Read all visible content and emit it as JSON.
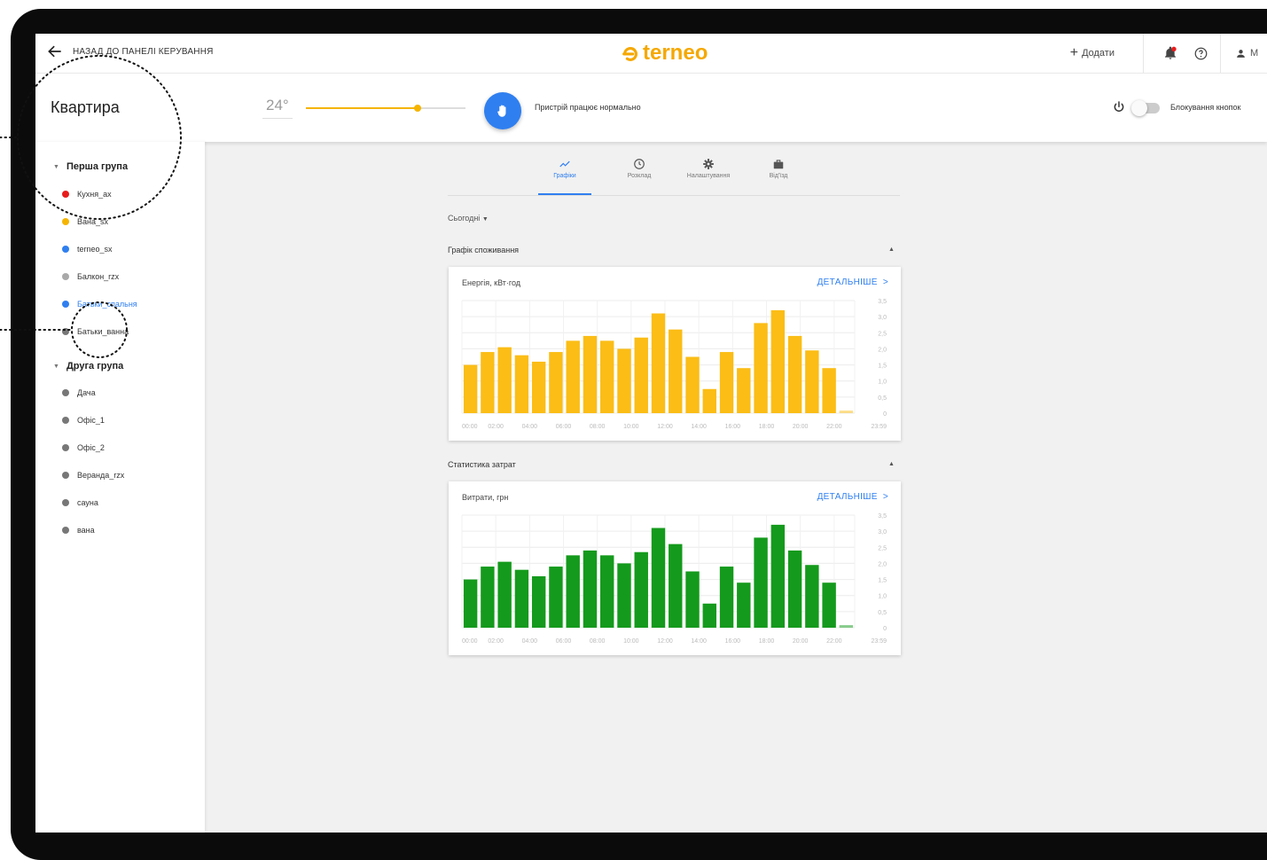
{
  "topbar": {
    "back_label": "НАЗАД ДО ПАНЕЛІ КЕРУВАННЯ",
    "logo_text": "terneo",
    "add_label": "Додати",
    "user_label": "M"
  },
  "device": {
    "room_title": "Квартира",
    "temperature": "24°",
    "status_text": "Пристрій працює нормально",
    "lock_label": "Блокування кнопок",
    "slider_level": 0.7
  },
  "sidebar": {
    "groups": [
      {
        "name": "Перша група",
        "items": [
          {
            "label": "Кухня_ах",
            "color": "#e81b1b"
          },
          {
            "label": "Вана_sx",
            "color": "#f5b400"
          },
          {
            "label": "terneo_sx",
            "color": "#2f7ff0"
          },
          {
            "label": "Балкон_rzx",
            "color": "#a9a9a9"
          },
          {
            "label": "Батьки_спальня",
            "color": "#2f7ff0"
          },
          {
            "label": "Батьки_ванна",
            "color": "#777777"
          }
        ]
      },
      {
        "name": "Друга група",
        "items": [
          {
            "label": "Дача",
            "color": "#777777"
          },
          {
            "label": "Офіс_1",
            "color": "#777777"
          },
          {
            "label": "Офіс_2",
            "color": "#777777"
          },
          {
            "label": "Веранда_rzx",
            "color": "#777777"
          },
          {
            "label": "сауна",
            "color": "#777777"
          },
          {
            "label": "вана",
            "color": "#777777"
          }
        ]
      }
    ]
  },
  "tabs": [
    {
      "label": "Графіки",
      "icon": "chart-line-icon"
    },
    {
      "label": "Розклад",
      "icon": "clock-icon"
    },
    {
      "label": "Налаштування",
      "icon": "gear-icon"
    },
    {
      "label": "Від'їзд",
      "icon": "suitcase-icon"
    }
  ],
  "period": "Сьогодні",
  "sections": {
    "consumption_title": "Графік споживання",
    "costs_title": "Статистика затрат",
    "more_label": "ДЕТАЛЬНІШЕ"
  },
  "chart_data": [
    {
      "type": "bar",
      "title": "Енергія, кВт·год",
      "color": "#fbbd16",
      "x_ticks": [
        "00:00",
        "02:00",
        "04:00",
        "06:00",
        "08:00",
        "10:00",
        "12:00",
        "14:00",
        "16:00",
        "18:00",
        "20:00",
        "22:00",
        "23:59"
      ],
      "y_ticks": [
        "3,5",
        "3,0",
        "2,5",
        "2,0",
        "1,5",
        "1,0",
        "0,5",
        "0"
      ],
      "ylim": [
        0,
        3.5
      ],
      "values": [
        1.5,
        1.9,
        2.05,
        1.8,
        1.6,
        1.9,
        2.25,
        2.4,
        2.25,
        2.0,
        2.35,
        3.1,
        2.6,
        1.75,
        0.75,
        1.9,
        1.4,
        2.8,
        3.2,
        2.4,
        1.95,
        1.4,
        0.08
      ],
      "grid": true
    },
    {
      "type": "bar",
      "title": "Витрати, грн",
      "color": "#149a1c",
      "x_ticks": [
        "00:00",
        "02:00",
        "04:00",
        "06:00",
        "08:00",
        "10:00",
        "12:00",
        "14:00",
        "16:00",
        "18:00",
        "20:00",
        "22:00",
        "23:59"
      ],
      "y_ticks": [
        "3,5",
        "3,0",
        "2,5",
        "2,0",
        "1,5",
        "1,0",
        "0,5",
        "0"
      ],
      "ylim": [
        0,
        3.5
      ],
      "values": [
        1.5,
        1.9,
        2.05,
        1.8,
        1.6,
        1.9,
        2.25,
        2.4,
        2.25,
        2.0,
        2.35,
        3.1,
        2.6,
        1.75,
        0.75,
        1.9,
        1.4,
        2.8,
        3.2,
        2.4,
        1.95,
        1.4,
        0.08
      ],
      "grid": true
    }
  ]
}
